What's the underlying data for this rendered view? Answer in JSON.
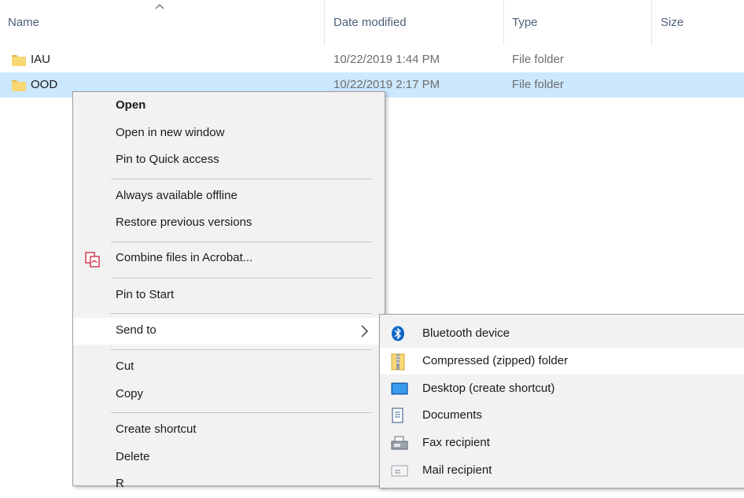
{
  "columns": {
    "name": "Name",
    "date_modified": "Date modified",
    "type": "Type",
    "size": "Size"
  },
  "files": [
    {
      "name": "IAU",
      "date": "10/22/2019 1:44 PM",
      "type": "File folder",
      "icon": "folder-icon"
    },
    {
      "name": "OOD",
      "date": "10/22/2019 2:17 PM",
      "type": "File folder",
      "icon": "folder-icon",
      "selected": true
    }
  ],
  "context_menu": {
    "open": "Open",
    "open_new_window": "Open in new window",
    "pin_quick_access": "Pin to Quick access",
    "always_offline": "Always available offline",
    "restore_previous": "Restore previous versions",
    "combine_acrobat": "Combine files in Acrobat...",
    "pin_to_start": "Pin to Start",
    "send_to": "Send to",
    "cut": "Cut",
    "copy": "Copy",
    "create_shortcut": "Create shortcut",
    "delete": "Delete",
    "next_partial": "R"
  },
  "send_to_menu": {
    "bluetooth": "Bluetooth device",
    "compressed": "Compressed (zipped) folder",
    "desktop": "Desktop (create shortcut)",
    "documents": "Documents",
    "fax": "Fax recipient",
    "mail": "Mail recipient"
  },
  "colors": {
    "selection": "#cce8ff",
    "menu_bg": "#f2f2f2",
    "folder": "#f8d775",
    "bluetooth": "#0a64c8"
  }
}
